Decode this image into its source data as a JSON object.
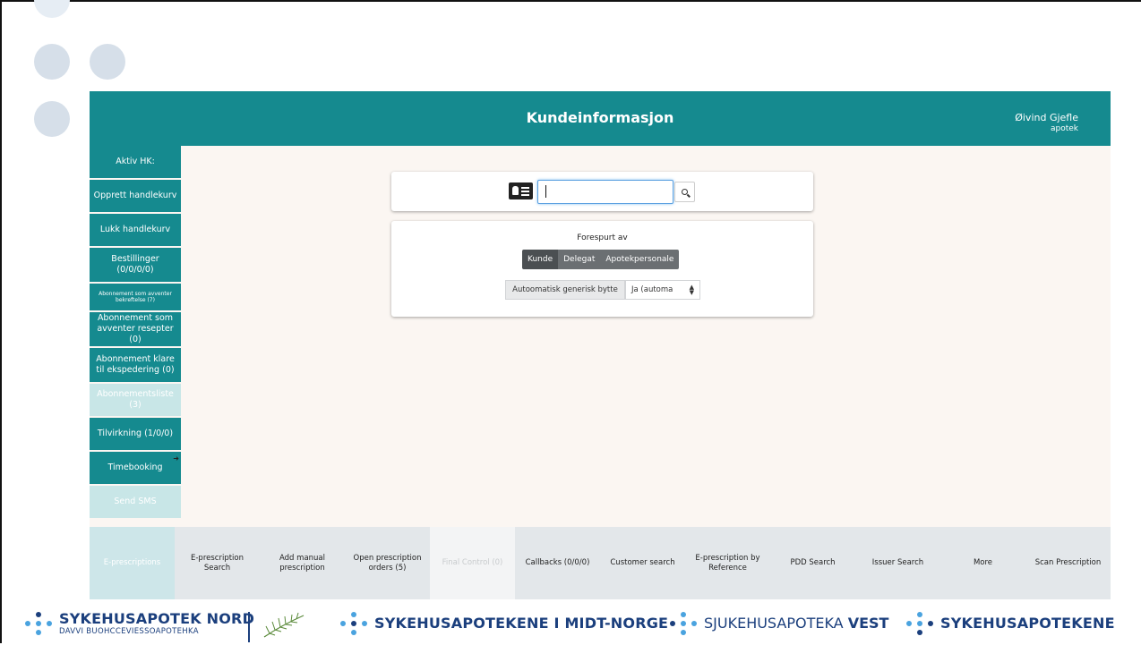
{
  "header": {
    "title": "Kundeinformasjon",
    "user_name": "Øivind Gjefle",
    "user_role": "apotek"
  },
  "sidebar": {
    "items": [
      {
        "label": "Aktiv HK:",
        "state": "normal"
      },
      {
        "label": "Opprett handlekurv",
        "state": "normal"
      },
      {
        "label": "Lukk handlekurv",
        "state": "normal"
      },
      {
        "label": "Bestillinger (0/0/0/0)",
        "state": "normal"
      },
      {
        "label": "Abonnement som avventer bekreftelse (7)",
        "state": "tiny"
      },
      {
        "label": "Abonnement som avventer resepter (0)",
        "state": "normal"
      },
      {
        "label": "Abonnement klare til ekspedering (0)",
        "state": "normal"
      },
      {
        "label": "Abonnementsliste (3)",
        "state": "disabled"
      },
      {
        "label": "Tilvirkning (1/0/0)",
        "state": "normal"
      },
      {
        "label": "Timebooking",
        "state": "normal"
      },
      {
        "label": "Send SMS",
        "state": "disabled"
      }
    ]
  },
  "search": {
    "placeholder": "",
    "value": ""
  },
  "requested_by": {
    "label": "Forespurt av",
    "options": [
      "Kunde",
      "Delegat",
      "Apotekpersonale"
    ],
    "selected": "Kunde"
  },
  "generic_swap": {
    "label": "Autoomatisk generisk bytte",
    "selected": "Ja (automa"
  },
  "tabs": [
    {
      "label": "E-prescriptions",
      "state": "active"
    },
    {
      "label": "E-prescription Search",
      "state": "normal"
    },
    {
      "label": "Add manual prescription",
      "state": "normal"
    },
    {
      "label": "Open prescription orders (5)",
      "state": "normal"
    },
    {
      "label": "Final Control (0)",
      "state": "disabled"
    },
    {
      "label": "Callbacks (0/0/0)",
      "state": "normal"
    },
    {
      "label": "Customer search",
      "state": "normal"
    },
    {
      "label": "E-prescription by Reference",
      "state": "normal"
    },
    {
      "label": "PDD Search",
      "state": "normal"
    },
    {
      "label": "Issuer Search",
      "state": "normal"
    },
    {
      "label": "More",
      "state": "normal"
    },
    {
      "label": "Scan Prescription",
      "state": "normal"
    }
  ],
  "footer": {
    "logo1_name": "SYKEHUSAPOTEK NORD",
    "logo1_sub": "DAVVI BUOHCCEVIESSOAPOTEHKA",
    "logo2_name": "SYKEHUSAPOTEKENE I MIDT-NORGE",
    "logo3_name_a": "SJUKEHUSAPOTEKA ",
    "logo3_name_b": "VEST",
    "logo4_name": "SYKEHUSAPOTEKENE"
  },
  "colors": {
    "teal": "#158a8f",
    "teal_disabled": "#c8e6e7",
    "navy": "#1b3f7d",
    "light_blue": "#4aa3df",
    "content_bg": "#fbf6f2"
  },
  "icons": {
    "id_card": "id-card-icon",
    "search": "search-icon",
    "arrow": "arrow-right-icon",
    "select": "select-updown-icon"
  }
}
